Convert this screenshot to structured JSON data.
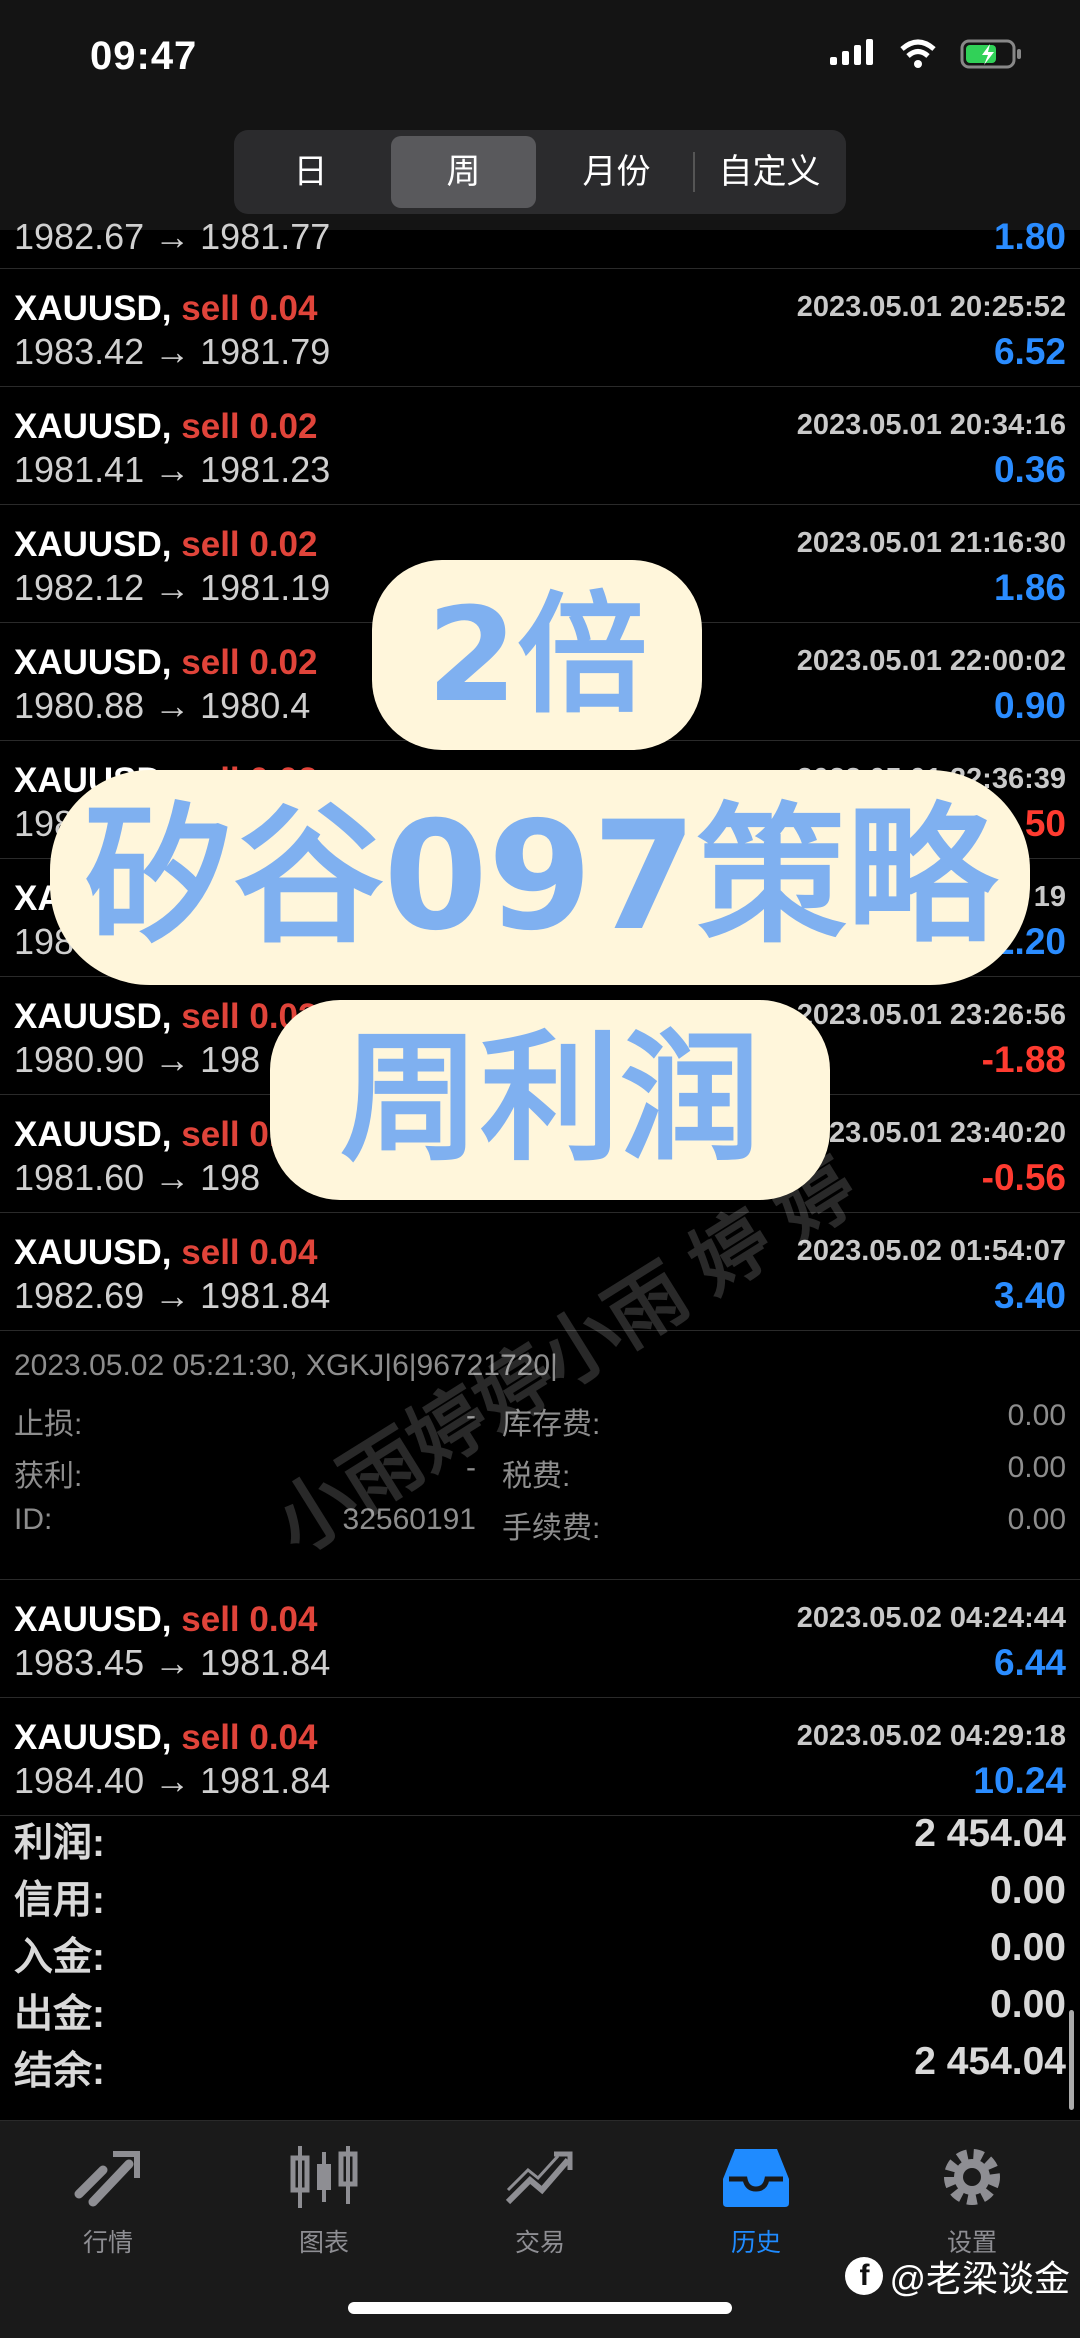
{
  "status_bar": {
    "time": "09:47"
  },
  "segments": [
    "日",
    "周",
    "月份",
    "自定义"
  ],
  "segment_active_index": 1,
  "partial_row": {
    "prices": "1982.67 → 1981.77",
    "profit": "1.80"
  },
  "trades": [
    {
      "symbol": "XAUUSD,",
      "side": "sell 0.04",
      "datetime": "2023.05.01 20:25:52",
      "prices": "1983.42 → 1981.79",
      "profit": "6.52",
      "sign": "pos"
    },
    {
      "symbol": "XAUUSD,",
      "side": "sell 0.02",
      "datetime": "2023.05.01 20:34:16",
      "prices": "1981.41 → 1981.23",
      "profit": "0.36",
      "sign": "pos"
    },
    {
      "symbol": "XAUUSD,",
      "side": "sell 0.02",
      "datetime": "2023.05.01 21:16:30",
      "prices": "1982.12 → 1981.19",
      "profit": "1.86",
      "sign": "pos"
    },
    {
      "symbol": "XAUUSD,",
      "side": "sell 0.02",
      "datetime": "2023.05.01 22:00:02",
      "prices": "1980.88 → 1980.4",
      "profit": "0.90",
      "sign": "pos"
    },
    {
      "symbol": "XAUUSD,",
      "side": "sell 0.02",
      "datetime": "2023.05.01 22:36:39",
      "prices": "198",
      "profit": "50",
      "sign": "neg"
    },
    {
      "symbol": "XA",
      "side": "",
      "datetime": "19",
      "prices": "198",
      "profit": "2.20",
      "sign": "pos"
    },
    {
      "symbol": "XAUUSD,",
      "side": "sell 0.02",
      "datetime": "2023.05.01 23:26:56",
      "prices": "1980.90 → 198",
      "profit": "-1.88",
      "sign": "neg"
    },
    {
      "symbol": "XAUUSD,",
      "side": "sell 0.0",
      "datetime": "2023.05.01 23:40:20",
      "prices": "1981.60 → 198",
      "profit": "-0.56",
      "sign": "neg"
    },
    {
      "symbol": "XAUUSD,",
      "side": "sell 0.04",
      "datetime": "2023.05.02 01:54:07",
      "prices": "1982.69 → 1981.84",
      "profit": "3.40",
      "sign": "pos"
    }
  ],
  "detail": {
    "header": "2023.05.02 05:21:30, XGKJ|6|96721720|",
    "rows": [
      {
        "label1": "止损:",
        "value1": "-",
        "label2": "库存费:",
        "value2": "0.00"
      },
      {
        "label1": "获利:",
        "value1": "-",
        "label2": "税费:",
        "value2": "0.00"
      },
      {
        "label1": "ID:",
        "value1": "32560191",
        "label2": "手续费:",
        "value2": "0.00"
      }
    ]
  },
  "trades_after": [
    {
      "symbol": "XAUUSD,",
      "side": "sell 0.04",
      "datetime": "2023.05.02 04:24:44",
      "prices": "1983.45 → 1981.84",
      "profit": "6.44",
      "sign": "pos"
    },
    {
      "symbol": "XAUUSD,",
      "side": "sell 0.04",
      "datetime": "2023.05.02 04:29:18",
      "prices": "1984.40 → 1981.84",
      "profit": "10.24",
      "sign": "pos"
    }
  ],
  "summary": [
    {
      "label": "利润:",
      "value": "2 454.04"
    },
    {
      "label": "信用:",
      "value": "0.00"
    },
    {
      "label": "入金:",
      "value": "0.00"
    },
    {
      "label": "出金:",
      "value": "0.00"
    },
    {
      "label": "结余:",
      "value": "2 454.04"
    }
  ],
  "tabs": [
    {
      "label": "行情",
      "icon": "quotes-icon"
    },
    {
      "label": "图表",
      "icon": "chart-icon"
    },
    {
      "label": "交易",
      "icon": "trade-icon"
    },
    {
      "label": "历史",
      "icon": "history-icon"
    },
    {
      "label": "设置",
      "icon": "settings-icon"
    }
  ],
  "tab_active_index": 3,
  "overlay": {
    "line1": "2倍",
    "line2": "矽谷097策略",
    "line3": "周利润",
    "watermark": "小雨婷婷小雨 婷 婷",
    "credit": "@老梁谈金"
  },
  "colors": {
    "accent": "#1f8bff",
    "sell": "#e0443a",
    "negative": "#ff3b30",
    "positive": "#2a8cff",
    "sticker_bg": "#fff6db",
    "sticker_text": "#7fb0f0"
  }
}
